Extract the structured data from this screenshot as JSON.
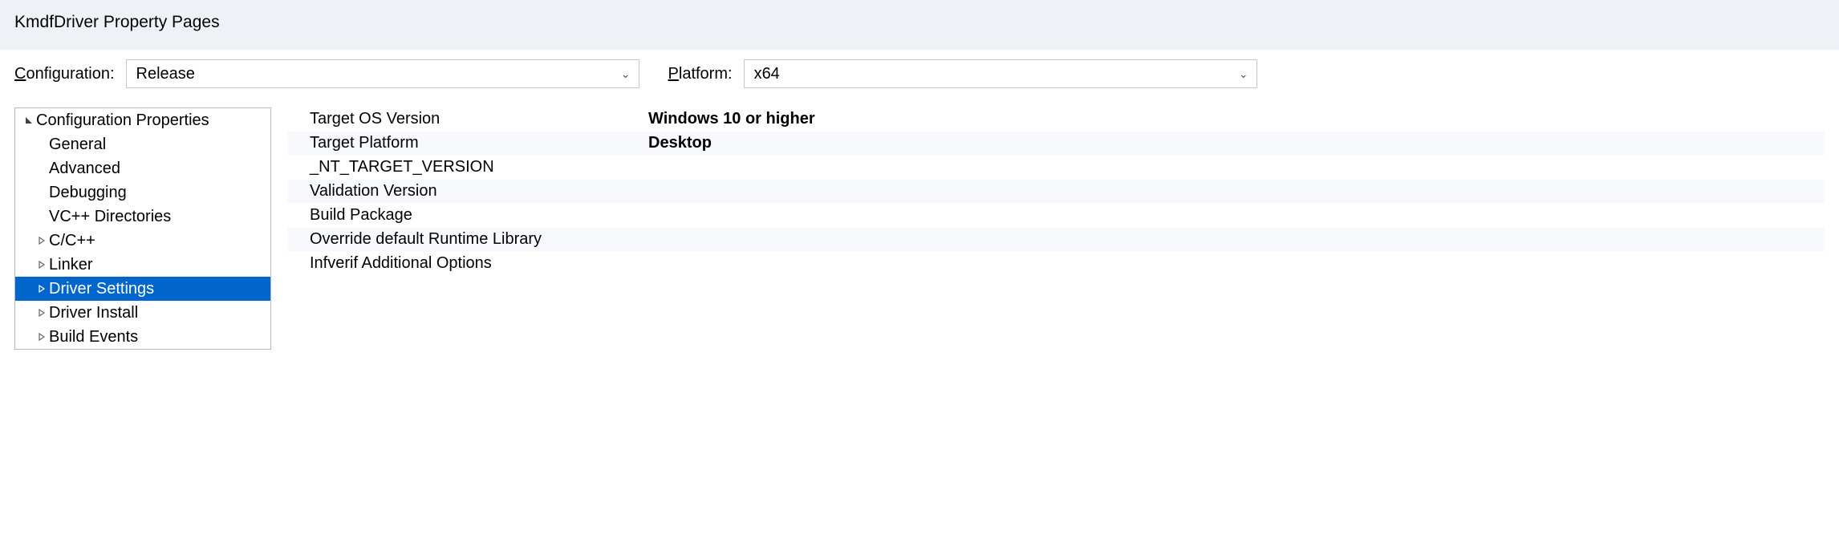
{
  "window_title": "KmdfDriver Property Pages",
  "config": {
    "label": "Configuration:",
    "value": "Release"
  },
  "platform": {
    "label": "Platform:",
    "value": "x64"
  },
  "tree": {
    "root": "Configuration Properties",
    "items": [
      {
        "label": "General",
        "expandable": false
      },
      {
        "label": "Advanced",
        "expandable": false
      },
      {
        "label": "Debugging",
        "expandable": false
      },
      {
        "label": "VC++ Directories",
        "expandable": false
      },
      {
        "label": "C/C++",
        "expandable": true
      },
      {
        "label": "Linker",
        "expandable": true
      },
      {
        "label": "Driver Settings",
        "expandable": true,
        "selected": true
      },
      {
        "label": "Driver Install",
        "expandable": true
      },
      {
        "label": "Build Events",
        "expandable": true
      }
    ]
  },
  "grid": {
    "rows": [
      {
        "name": "Target OS Version",
        "value": "Windows 10 or higher"
      },
      {
        "name": "Target Platform",
        "value": "Desktop"
      },
      {
        "name": "_NT_TARGET_VERSION",
        "value": ""
      },
      {
        "name": "Validation Version",
        "value": ""
      },
      {
        "name": "Build Package",
        "value": ""
      },
      {
        "name": "Override default Runtime Library",
        "value": ""
      },
      {
        "name": "Infverif Additional Options",
        "value": ""
      }
    ]
  }
}
